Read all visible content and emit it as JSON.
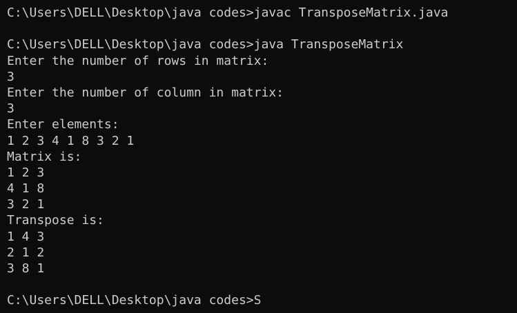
{
  "terminal": {
    "lines": [
      "C:\\Users\\DELL\\Desktop\\java codes>javac TransposeMatrix.java",
      "",
      "C:\\Users\\DELL\\Desktop\\java codes>java TransposeMatrix",
      "Enter the number of rows in matrix:",
      "3",
      "Enter the number of column in matrix:",
      "3",
      "Enter elements:",
      "1 2 3 4 1 8 3 2 1",
      "Matrix is:",
      "1 2 3",
      "4 1 8",
      "3 2 1",
      "Transpose is:",
      "1 4 3",
      "2 1 2",
      "3 8 1",
      ""
    ],
    "prompt": "C:\\Users\\DELL\\Desktop\\java codes>",
    "typed_input": "S"
  }
}
